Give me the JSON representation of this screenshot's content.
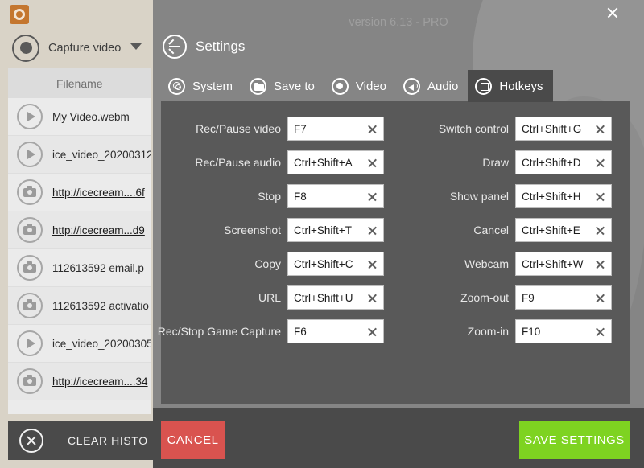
{
  "app": {
    "logo_icon": "icecream-logo-icon",
    "capture_mode_label": "Capture video",
    "capture_mode_icon": "record-dot-icon",
    "dropdown_icon": "chevron-down-icon"
  },
  "file_list": {
    "column_header": "Filename",
    "rows": [
      {
        "icon": "play-icon",
        "name": "My Video.webm",
        "is_link": false
      },
      {
        "icon": "play-icon",
        "name": "ice_video_20200312",
        "is_link": false
      },
      {
        "icon": "camera-icon",
        "name": "http://icecream....6f",
        "is_link": true
      },
      {
        "icon": "camera-icon",
        "name": "http://icecream...d9",
        "is_link": true
      },
      {
        "icon": "camera-icon",
        "name": "112613592 email.p",
        "is_link": false
      },
      {
        "icon": "camera-icon",
        "name": "112613592 activatio",
        "is_link": false
      },
      {
        "icon": "play-icon",
        "name": "ice_video_20200305",
        "is_link": false
      },
      {
        "icon": "camera-icon",
        "name": "http://icecream....34",
        "is_link": true
      }
    ]
  },
  "clear_history": {
    "label": "CLEAR HISTO",
    "icon": "close-circle-icon"
  },
  "settings": {
    "version": "version 6.13 - PRO",
    "title": "Settings",
    "back_icon": "back-arrow-icon",
    "close_icon": "close-icon",
    "tabs": [
      {
        "label": "System",
        "icon": "system-icon",
        "active": false
      },
      {
        "label": "Save to",
        "icon": "folder-icon",
        "active": false
      },
      {
        "label": "Video",
        "icon": "record-icon",
        "active": false
      },
      {
        "label": "Audio",
        "icon": "speaker-icon",
        "active": false
      },
      {
        "label": "Hotkeys",
        "icon": "hotkeys-icon",
        "active": true
      }
    ],
    "hotkeys_left": [
      {
        "label": "Rec/Pause video",
        "value": "F7"
      },
      {
        "label": "Rec/Pause audio",
        "value": "Ctrl+Shift+A"
      },
      {
        "label": "Stop",
        "value": "F8"
      },
      {
        "label": "Screenshot",
        "value": "Ctrl+Shift+T"
      },
      {
        "label": "Copy",
        "value": "Ctrl+Shift+C"
      },
      {
        "label": "URL",
        "value": "Ctrl+Shift+U"
      },
      {
        "label": "Rec/Stop Game Capture",
        "value": "F6"
      }
    ],
    "hotkeys_right": [
      {
        "label": "Switch control",
        "value": "Ctrl+Shift+G"
      },
      {
        "label": "Draw",
        "value": "Ctrl+Shift+D"
      },
      {
        "label": "Show panel",
        "value": "Ctrl+Shift+H"
      },
      {
        "label": "Cancel",
        "value": "Ctrl+Shift+E"
      },
      {
        "label": "Webcam",
        "value": "Ctrl+Shift+W"
      },
      {
        "label": "Zoom-out",
        "value": "F9"
      },
      {
        "label": "Zoom-in",
        "value": "F10"
      }
    ],
    "footer": {
      "cancel_label": "CANCEL",
      "save_label": "SAVE SETTINGS",
      "cancel_color": "#d9534f",
      "save_color": "#7ed321"
    }
  }
}
